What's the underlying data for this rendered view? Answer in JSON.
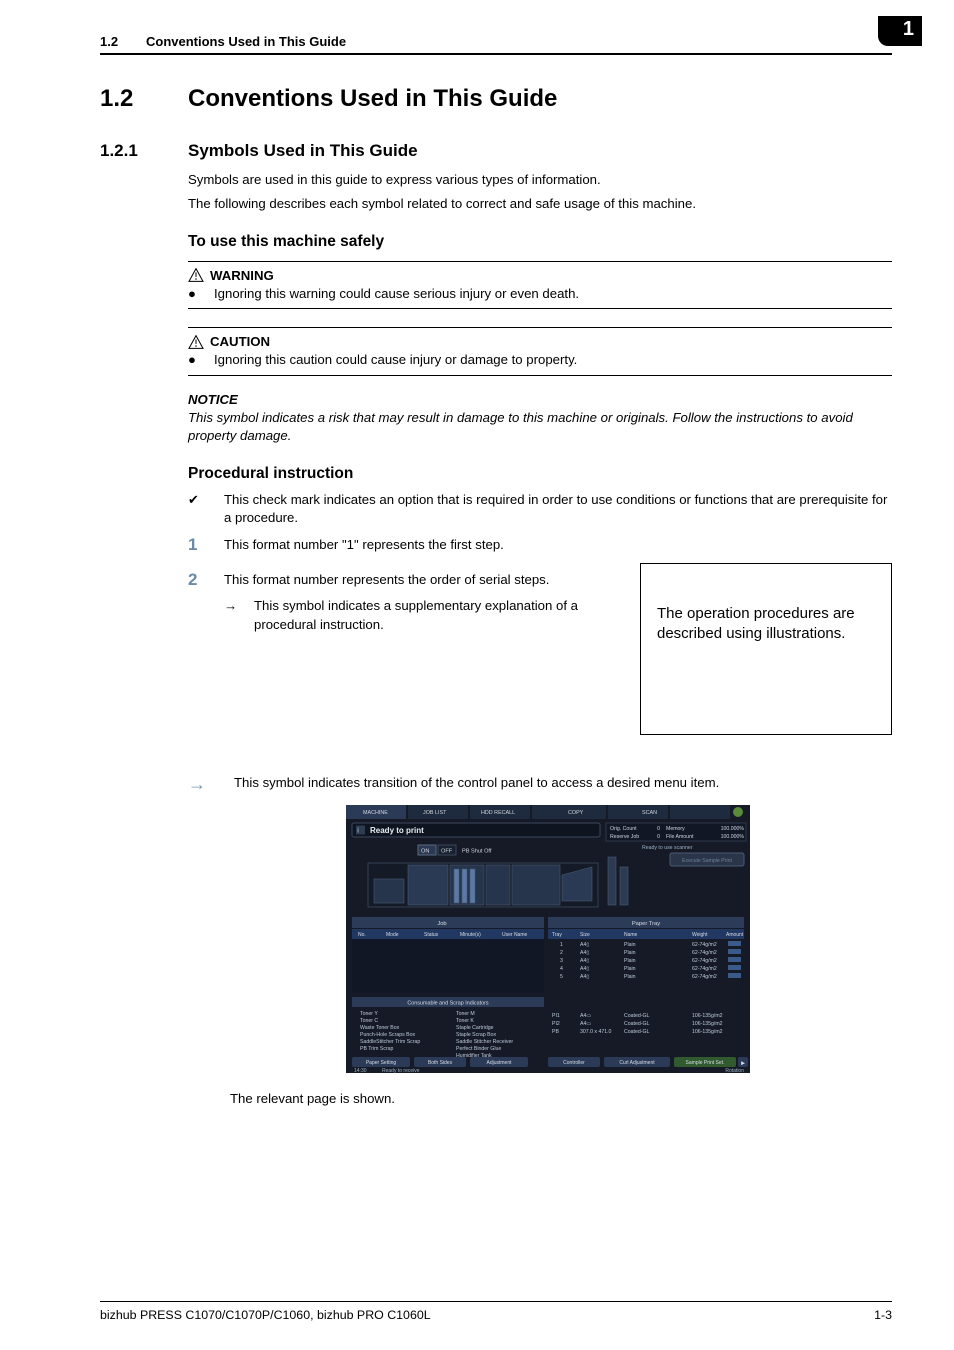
{
  "page_tab": "1",
  "header": {
    "number": "1.2",
    "title": "Conventions Used in This Guide"
  },
  "h1": {
    "number": "1.2",
    "title": "Conventions Used in This Guide"
  },
  "h2": {
    "number": "1.2.1",
    "title": "Symbols Used in This Guide"
  },
  "intro": {
    "line1": "Symbols are used in this guide to express various types of information.",
    "line2": "The following describes each symbol related to correct and safe usage of this machine."
  },
  "safely_heading": "To use this machine safely",
  "warning": {
    "label": "WARNING",
    "text": "Ignoring this warning could cause serious injury or even death."
  },
  "caution": {
    "label": "CAUTION",
    "text": "Ignoring this caution could cause injury or damage to property."
  },
  "notice": {
    "label": "NOTICE",
    "text": "This symbol indicates a risk that may result in damage to this machine or originals. Follow the instructions to avoid property damage."
  },
  "procedural_heading": "Procedural instruction",
  "checkmark_text": "This check mark indicates an option that is required in order to use conditions or functions that are prerequisite for a procedure.",
  "step1": "This format number \"1\" represents the first step.",
  "step2": "This format number represents the order of serial steps.",
  "substep_text": "This symbol indicates a supplementary explanation of a procedural instruction.",
  "illus_box_text": "The operation procedures are described using illustrations.",
  "transition_text": "This symbol indicates transition of the control panel to access a desired menu item.",
  "relevant_text": "The relevant page is shown.",
  "panel": {
    "tabs": [
      "MACHINE",
      "JOB LIST",
      "HDD RECALL",
      "COPY",
      "SCAN"
    ],
    "ready": "Ready to print",
    "pb_shut": "PB Shut Off",
    "toggle": {
      "on": "ON",
      "off": "OFF"
    },
    "orig_count": "Orig. Count",
    "reserve_job": "Reserve Job",
    "memory": "Memory",
    "file_amount": "File Amount",
    "mem_pct": "100.000%",
    "file_pct": "100.000%",
    "zero": "0",
    "ready_scanner": "Ready to use scanner",
    "sample_btn": "Execute Sample Print",
    "job_header": "Job",
    "job_cols": [
      "No.",
      "Mode",
      "Status",
      "Minute(s)",
      "User Name"
    ],
    "tray_header": "Paper Tray",
    "tray_cols": [
      "Tray",
      "Size",
      "Name",
      "Weight",
      "Amount"
    ],
    "tray_rows": [
      {
        "tray": "1",
        "size": "A4▯",
        "name": "Plain",
        "weight": "62-74g/m2"
      },
      {
        "tray": "2",
        "size": "A4▯",
        "name": "Plain",
        "weight": "62-74g/m2"
      },
      {
        "tray": "3",
        "size": "A4▯",
        "name": "Plain",
        "weight": "62-74g/m2"
      },
      {
        "tray": "4",
        "size": "A4▯",
        "name": "Plain",
        "weight": "62-74g/m2"
      },
      {
        "tray": "5",
        "size": "A4▯",
        "name": "Plain",
        "weight": "62-74g/m2"
      }
    ],
    "pi_rows": [
      {
        "tray": "PI1",
        "size": "A4▭",
        "name": "Coated-GL",
        "weight": "106-135g/m2"
      },
      {
        "tray": "PI2",
        "size": "A4▭",
        "name": "Coated-GL",
        "weight": "106-135g/m2"
      },
      {
        "tray": "PB",
        "size": "307.0 x 471.0",
        "name": "Coated-GL",
        "weight": "106-135g/m2"
      }
    ],
    "consumable_header": "Consumable and Scrap Indicators",
    "cons_left": [
      "Toner Y",
      "Toner C",
      "Waste Toner Box",
      "Punch-Hole Scraps Box",
      "SaddleStitcher Trim Scrap",
      "PB Trim Scrap"
    ],
    "cons_right": [
      "Toner M",
      "Toner K",
      "Staple Cartridge",
      "Staple Scrap Box",
      "Saddle Stitcher Receiver",
      "Perfect Binder Glue",
      "Humidifier Tank"
    ],
    "buttons": [
      "Paper Setting",
      "Both Sides",
      "Adjustment",
      "Controller",
      "Curl Adjustment",
      "Sample Print Set."
    ],
    "time": "14:30",
    "receive": "Ready to receive",
    "rotation": "Rotation"
  },
  "footer": {
    "left": "bizhub PRESS C1070/C1070P/C1060, bizhub PRO C1060L",
    "right": "1-3"
  }
}
